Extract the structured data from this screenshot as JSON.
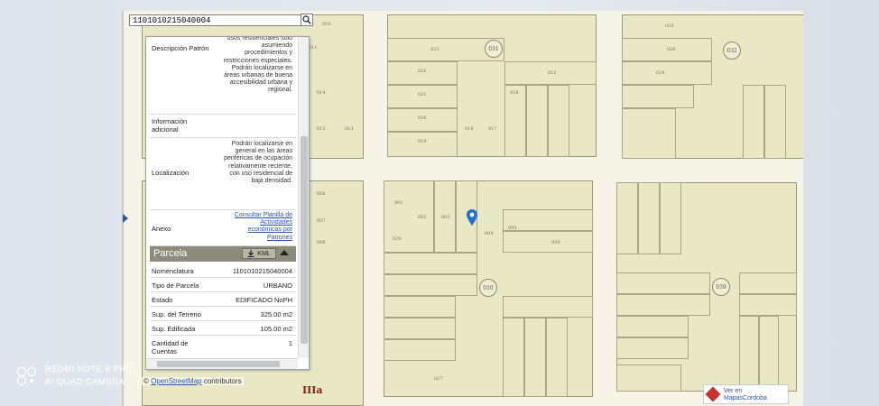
{
  "search": {
    "value": "1101010215040004"
  },
  "panel": {
    "descripcion_key": "Descripción Patrón",
    "descripcion_val": "usos residenciales sólo asumiendo procedimientos y restricciones especiales. Podrán localizarse en áreas urbanas de buena accesibilidad urbana y regional.",
    "info_key": "Información adicional",
    "localizacion_key": "Localización",
    "localizacion_val": "Podrán localizarse en general en las áreas periféricas de ocupación relativamente reciente, con uso residencial de baja densidad.",
    "anexo_key": "Anexo",
    "anexo_val": "Consultar Planilla de Actividades económicas por Patrones",
    "parcela_title": "Parcela",
    "kml_label": "KML",
    "rows": [
      {
        "key": "Nomenclatura",
        "value": "1101010215040004"
      },
      {
        "key": "Tipo de Parcela",
        "value": "URBANO"
      },
      {
        "key": "Estado",
        "value": "EDIFICADO NoPH"
      },
      {
        "key": "Sup. del Terreno",
        "value": "325.00 m2"
      },
      {
        "key": "Sup. Edificada",
        "value": "105.00 m2"
      },
      {
        "key": "Cantidad de Cuentas",
        "value": "1"
      }
    ]
  },
  "map": {
    "zone_label": "IIIa",
    "block_numbers": [
      "031",
      "032",
      "010",
      "039"
    ],
    "lot_numbers": [
      "010",
      "011",
      "012",
      "013",
      "014",
      "015",
      "016",
      "017",
      "018",
      "019",
      "020",
      "021",
      "022",
      "023",
      "024",
      "025",
      "026",
      "001",
      "002",
      "003",
      "004",
      "005",
      "006",
      "007",
      "008",
      "009",
      "029",
      "027"
    ]
  },
  "attribution": {
    "prefix": "©",
    "link": "OpenStreetMap",
    "suffix": "contributors"
  },
  "ver_en": {
    "line1": "Ver en",
    "line2": "MapasCordoba"
  },
  "watermark": {
    "line1": "REDMI NOTE 8 PRO",
    "line2": "AI QUAD CAMERA"
  },
  "colors": {
    "lot_fill": "#e9e8c4",
    "panel_bar": "#8c8b7c",
    "zone_label": "#8a1b14",
    "marker": "#1f6fd1"
  }
}
